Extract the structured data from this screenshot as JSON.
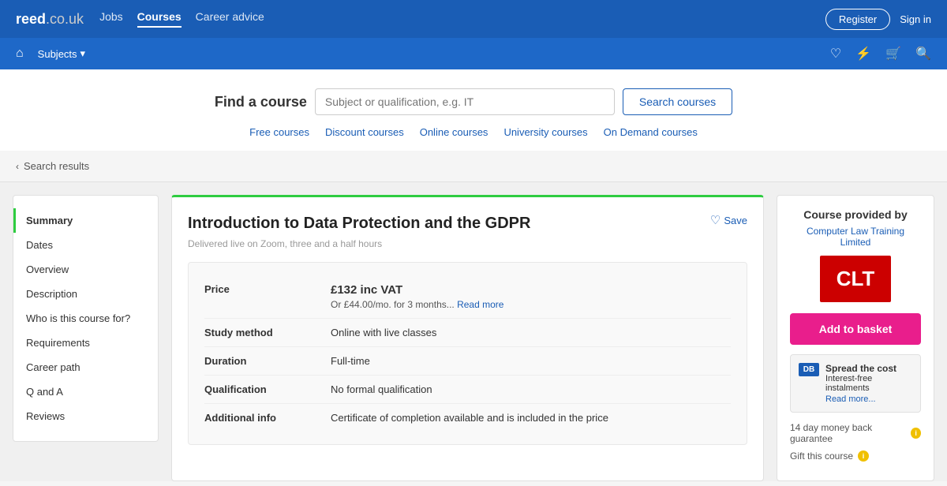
{
  "topNav": {
    "logo": "reed",
    "logoDomain": ".co.uk",
    "links": [
      "Jobs",
      "Courses",
      "Career advice"
    ],
    "activeLink": "Courses",
    "registerLabel": "Register",
    "signInLabel": "Sign in"
  },
  "secondNav": {
    "homeIcon": "⌂",
    "subjectsLabel": "Subjects",
    "chevron": "▾",
    "icons": [
      "♡",
      "⚡",
      "🛒",
      "🔍"
    ]
  },
  "search": {
    "findLabel": "Find a course",
    "placeholder": "Subject or qualification, e.g. IT",
    "buttonLabel": "Search courses",
    "links": [
      "Free courses",
      "Discount courses",
      "Online courses",
      "University courses",
      "On Demand courses"
    ]
  },
  "backLink": "Search results",
  "sidebar": {
    "items": [
      {
        "label": "Summary",
        "active": true
      },
      {
        "label": "Dates",
        "active": false
      },
      {
        "label": "Overview",
        "active": false
      },
      {
        "label": "Description",
        "active": false
      },
      {
        "label": "Who is this course for?",
        "active": false
      },
      {
        "label": "Requirements",
        "active": false
      },
      {
        "label": "Career path",
        "active": false
      },
      {
        "label": "Q and A",
        "active": false
      },
      {
        "label": "Reviews",
        "active": false
      }
    ]
  },
  "course": {
    "title": "Introduction to Data Protection and the GDPR",
    "deliveredText": "Delivered live on Zoom, three and a half hours",
    "saveLabel": "Save",
    "details": [
      {
        "label": "Price",
        "priceMain": "£132 inc VAT",
        "priceSub": "Or £44.00/mo. for 3 months...",
        "readMore": "Read more"
      },
      {
        "label": "Study method",
        "value": "Online with live classes"
      },
      {
        "label": "Duration",
        "value": "Full-time"
      },
      {
        "label": "Qualification",
        "value": "No formal qualification"
      },
      {
        "label": "Additional info",
        "value": "Certificate of completion available and is included in the price"
      }
    ]
  },
  "rightSidebar": {
    "providerTitle": "Course provided by",
    "providerName": "Computer Law Training Limited",
    "providerLogoText": "CLT",
    "addToBasketLabel": "Add to basket",
    "spreadCost": {
      "dbLogoText": "DB",
      "title": "Spread the cost",
      "subtitle": "Interest-free instalments",
      "readMoreLabel": "Read more..."
    },
    "guaranteeLabel": "14 day money back guarantee",
    "giftLabel": "Gift this course"
  }
}
